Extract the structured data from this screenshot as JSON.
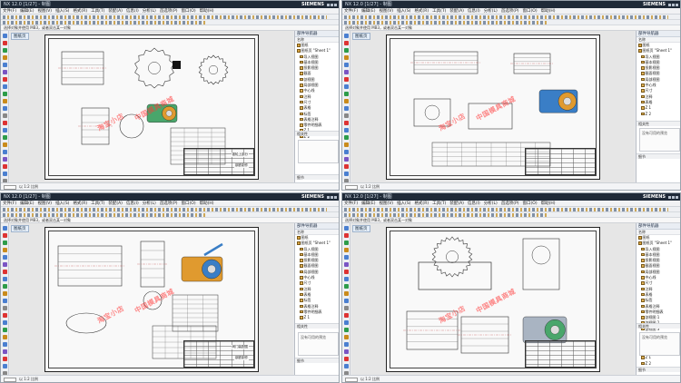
{
  "screens": [
    {
      "title": "NX 12.0 [1/27] - 制图",
      "brand": "SIEMENS",
      "menu": [
        "文件(F)",
        "编辑(E)",
        "视图(V)",
        "插入(S)",
        "格式(R)",
        "工具(T)",
        "装配(A)",
        "信息(I)",
        "分析(L)",
        "首选项(P)",
        "窗口(O)",
        "帮助(H)"
      ],
      "status_text": "选择对象并使用 MB3，或者双击某一对象",
      "tab": "图纸页",
      "navigator": {
        "title": "部件导航器",
        "column": "名称",
        "items": [
          "图纸",
          "图纸页 \"Sheet 1\"",
          "导入视图",
          "基本视图",
          "投影视图",
          "截面",
          "剖视图",
          "局部视图",
          "中心线",
          "注释",
          "尺寸",
          "表格",
          "标签",
          "表格注释",
          "零件明细表",
          "Z 1",
          "Z 2"
        ]
      },
      "detail_label": "",
      "foot1": "相关性",
      "foot2": "细节",
      "watermarks": [
        "淘宝小店",
        "中国模具商城"
      ],
      "title_block": [
        "锥轮上部分",
        "钢铁制作"
      ],
      "bottom": "以 1:2 比例"
    },
    {
      "title": "NX 12.0 [1/27] - 制图",
      "brand": "SIEMENS",
      "menu": [
        "文件(F)",
        "编辑(E)",
        "视图(V)",
        "插入(S)",
        "格式(R)",
        "工具(T)",
        "装配(A)",
        "信息(I)",
        "分析(L)",
        "首选项(P)",
        "窗口(O)",
        "帮助(H)"
      ],
      "status_text": "选择对象并使用 MB3，或者双击某一对象",
      "tab": "图纸页",
      "navigator": {
        "title": "部件导航器",
        "column": "名称",
        "items": [
          "图纸",
          "图纸页 \"Sheet 1\"",
          "导入视图",
          "基本视图",
          "投影视图",
          "截面视图",
          "局部视图",
          "中心线",
          "尺寸",
          "注释",
          "表格",
          "Z 1",
          "Z 2"
        ]
      },
      "detail_label": "没有可用的预览",
      "foot1": "相关性",
      "foot2": "细节",
      "watermarks": [
        "淘宝小店",
        "中国模具商城"
      ],
      "title_block": [
        "",
        ""
      ],
      "bottom": "以 1:2 比例"
    },
    {
      "title": "NX 12.0 [1/27] - 制图",
      "brand": "SIEMENS",
      "menu": [
        "文件(F)",
        "编辑(E)",
        "视图(V)",
        "插入(S)",
        "格式(R)",
        "工具(T)",
        "装配(A)",
        "信息(I)",
        "分析(L)",
        "首选项(P)",
        "窗口(O)",
        "帮助(H)"
      ],
      "status_text": "选择对象并使用 MB3，或者双击某一对象",
      "tab": "图纸页",
      "navigator": {
        "title": "部件导航器",
        "column": "名称",
        "items": [
          "图纸",
          "图纸页 \"Sheet 1\"",
          "导入视图",
          "基本视图",
          "投影视图",
          "截面视图",
          "局部视图",
          "中心线",
          "尺寸",
          "注释",
          "表格",
          "标签",
          "表格注释",
          "零件明细表",
          "Z 1"
        ]
      },
      "detail_label": "没有可用的预览",
      "foot1": "相关性",
      "foot2": "细节",
      "watermarks": [
        "淘宝小店",
        "中国模具商城"
      ],
      "title_block": [
        "阀门装配图",
        "钢铁制作"
      ],
      "bottom": "以 1:2 比例"
    },
    {
      "title": "NX 12.0 [1/27] - 制图",
      "brand": "SIEMENS",
      "menu": [
        "文件(F)",
        "编辑(E)",
        "视图(V)",
        "插入(S)",
        "格式(R)",
        "工具(T)",
        "装配(A)",
        "信息(I)",
        "分析(L)",
        "首选项(P)",
        "窗口(O)",
        "帮助(H)"
      ],
      "status_text": "选择对象并使用 MB3，或者双击某一对象",
      "tab": "图纸页",
      "navigator": {
        "title": "部件导航器",
        "column": "名称",
        "items": [
          "图纸",
          "图纸页 \"Sheet 1\"",
          "导入视图",
          "基本视图",
          "投影视图",
          "截面视图",
          "局部视图",
          "中心线",
          "尺寸",
          "注释",
          "表格",
          "标签",
          "表格注释",
          "零件明细表",
          "剖视图 1",
          "剖视图 2",
          "剖视图 3",
          "局部视图 1",
          "局部视图 2",
          "投影视图 1",
          "投影视图 2",
          "Z 1",
          "Z 2"
        ]
      },
      "detail_label": "没有可用的预览",
      "foot1": "相关性",
      "foot2": "细节",
      "watermarks": [
        "淘宝小店",
        "中国模具商城"
      ],
      "title_block": [
        "",
        ""
      ],
      "bottom": "以 1:2 比例"
    }
  ],
  "icons": {
    "left_toolbar": [
      "select-icon",
      "line-icon",
      "circle-icon",
      "dimension-icon",
      "note-icon",
      "view-icon",
      "section-icon",
      "layer-icon",
      "snap-icon",
      "settings-icon",
      "help-icon",
      "history-icon"
    ],
    "colors": {
      "titlebar": "#1f2a38",
      "canvas": "#e6e6e6",
      "sheet": "#f9f9f9",
      "folder": "#d9a441",
      "watermark": "#ff3b3b",
      "model_green": "#49a66b",
      "model_orange": "#e09a2f",
      "model_blue": "#3a7ec6"
    }
  }
}
